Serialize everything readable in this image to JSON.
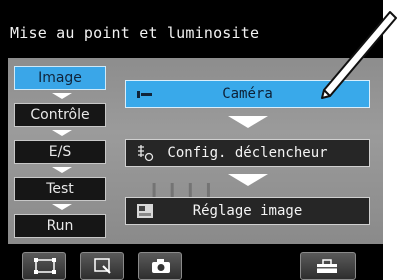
{
  "title": "Mise au point et luminosite",
  "nav": {
    "tabs": [
      {
        "label": "Image",
        "active": true
      },
      {
        "label": "Contrôle",
        "active": false
      },
      {
        "label": "E/S",
        "active": false
      },
      {
        "label": "Test",
        "active": false
      },
      {
        "label": "Run",
        "active": false
      }
    ]
  },
  "steps": [
    {
      "label": "Caméra",
      "icon": "camera-setting-icon",
      "active": true
    },
    {
      "label": "Config. déclencheur",
      "icon": "trigger-config-icon",
      "active": false
    },
    {
      "label": "Réglage image",
      "icon": "image-adjust-icon",
      "active": false
    }
  ],
  "bottom_toolbar": [
    "display-frame-icon",
    "zoom-icon",
    "camera-icon",
    "tools-icon"
  ],
  "colors": {
    "accent": "#39a9ea",
    "background": "#000000"
  }
}
